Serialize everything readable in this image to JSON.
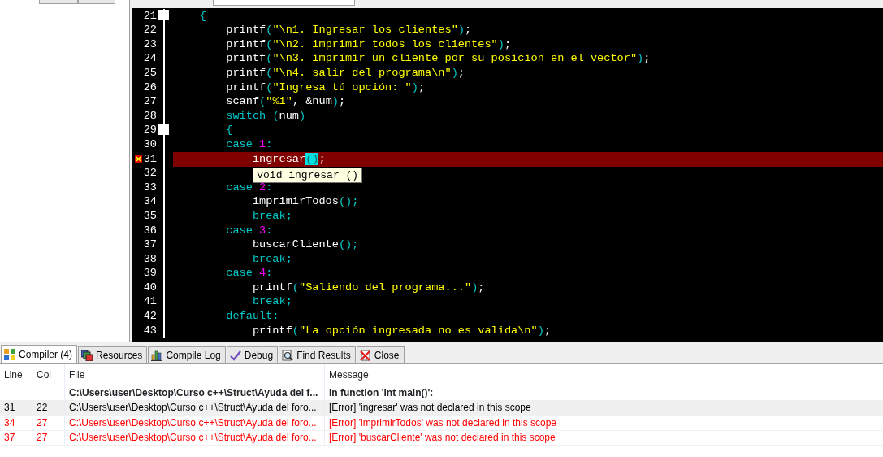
{
  "editor": {
    "lines": [
      {
        "number": "21",
        "fold": true,
        "error": false,
        "tokens": [
          {
            "kind": "punct",
            "text": "    {"
          }
        ]
      },
      {
        "number": "22",
        "fold": false,
        "error": false,
        "tokens": [
          {
            "kind": "plain",
            "text": "        printf"
          },
          {
            "kind": "punct",
            "text": "("
          },
          {
            "kind": "str",
            "text": "\"\\n1. Ingresar los clientes\""
          },
          {
            "kind": "punct",
            "text": ")"
          },
          {
            "kind": "plain",
            "text": ";"
          }
        ]
      },
      {
        "number": "23",
        "fold": false,
        "error": false,
        "tokens": [
          {
            "kind": "plain",
            "text": "        printf"
          },
          {
            "kind": "punct",
            "text": "("
          },
          {
            "kind": "str",
            "text": "\"\\n2. imprimir todos los clientes\""
          },
          {
            "kind": "punct",
            "text": ")"
          },
          {
            "kind": "plain",
            "text": ";"
          }
        ]
      },
      {
        "number": "24",
        "fold": false,
        "error": false,
        "tokens": [
          {
            "kind": "plain",
            "text": "        printf"
          },
          {
            "kind": "punct",
            "text": "("
          },
          {
            "kind": "str",
            "text": "\"\\n3. imprimir un cliente por su posicion en el vector\""
          },
          {
            "kind": "punct",
            "text": ")"
          },
          {
            "kind": "plain",
            "text": ";"
          }
        ]
      },
      {
        "number": "25",
        "fold": false,
        "error": false,
        "tokens": [
          {
            "kind": "plain",
            "text": "        printf"
          },
          {
            "kind": "punct",
            "text": "("
          },
          {
            "kind": "str",
            "text": "\"\\n4. salir del programa\\n\""
          },
          {
            "kind": "punct",
            "text": ")"
          },
          {
            "kind": "plain",
            "text": ";"
          }
        ]
      },
      {
        "number": "26",
        "fold": false,
        "error": false,
        "tokens": [
          {
            "kind": "plain",
            "text": "        printf"
          },
          {
            "kind": "punct",
            "text": "("
          },
          {
            "kind": "str",
            "text": "\"Ingresa tú opción: \""
          },
          {
            "kind": "punct",
            "text": ")"
          },
          {
            "kind": "plain",
            "text": ";"
          }
        ]
      },
      {
        "number": "27",
        "fold": false,
        "error": false,
        "tokens": [
          {
            "kind": "plain",
            "text": "        scanf"
          },
          {
            "kind": "punct",
            "text": "("
          },
          {
            "kind": "str",
            "text": "\"%i\""
          },
          {
            "kind": "plain",
            "text": ", &num"
          },
          {
            "kind": "punct",
            "text": ")"
          },
          {
            "kind": "plain",
            "text": ";"
          }
        ]
      },
      {
        "number": "28",
        "fold": false,
        "error": false,
        "tokens": [
          {
            "kind": "kw",
            "text": "        switch "
          },
          {
            "kind": "punct",
            "text": "("
          },
          {
            "kind": "plain",
            "text": "num"
          },
          {
            "kind": "punct",
            "text": ")"
          }
        ]
      },
      {
        "number": "29",
        "fold": true,
        "error": false,
        "tokens": [
          {
            "kind": "punct",
            "text": "        {"
          }
        ]
      },
      {
        "number": "30",
        "fold": false,
        "error": false,
        "tokens": [
          {
            "kind": "kw",
            "text": "        case "
          },
          {
            "kind": "num",
            "text": "1"
          },
          {
            "kind": "punct",
            "text": ":"
          }
        ]
      },
      {
        "number": "31",
        "fold": false,
        "error": true,
        "tokens": [
          {
            "kind": "plain",
            "text": "            ingresar"
          },
          {
            "kind": "match",
            "text": "()"
          },
          {
            "kind": "plain",
            "text": ";"
          }
        ],
        "tooltip": "void ingresar ()"
      },
      {
        "number": "32",
        "fold": false,
        "error": false
      },
      {
        "number": "33",
        "fold": false,
        "error": false,
        "tokens": [
          {
            "kind": "kw",
            "text": "        case "
          },
          {
            "kind": "num",
            "text": "2"
          },
          {
            "kind": "punct",
            "text": ":"
          }
        ]
      },
      {
        "number": "34",
        "fold": false,
        "error": false,
        "tokens": [
          {
            "kind": "plain",
            "text": "            imprimirTodos"
          },
          {
            "kind": "punct",
            "text": "();"
          }
        ]
      },
      {
        "number": "35",
        "fold": false,
        "error": false,
        "tokens": [
          {
            "kind": "kw",
            "text": "            break;"
          }
        ]
      },
      {
        "number": "36",
        "fold": false,
        "error": false,
        "tokens": [
          {
            "kind": "kw",
            "text": "        case "
          },
          {
            "kind": "num",
            "text": "3"
          },
          {
            "kind": "punct",
            "text": ":"
          }
        ]
      },
      {
        "number": "37",
        "fold": false,
        "error": false,
        "tokens": [
          {
            "kind": "plain",
            "text": "            buscarCliente"
          },
          {
            "kind": "punct",
            "text": "();"
          }
        ]
      },
      {
        "number": "38",
        "fold": false,
        "error": false,
        "tokens": [
          {
            "kind": "kw",
            "text": "            break;"
          }
        ]
      },
      {
        "number": "39",
        "fold": false,
        "error": false,
        "tokens": [
          {
            "kind": "kw",
            "text": "        case "
          },
          {
            "kind": "num",
            "text": "4"
          },
          {
            "kind": "punct",
            "text": ":"
          }
        ]
      },
      {
        "number": "40",
        "fold": false,
        "error": false,
        "tokens": [
          {
            "kind": "plain",
            "text": "            printf"
          },
          {
            "kind": "punct",
            "text": "("
          },
          {
            "kind": "str",
            "text": "\"Saliendo del programa...\""
          },
          {
            "kind": "punct",
            "text": ")"
          },
          {
            "kind": "plain",
            "text": ";"
          }
        ]
      },
      {
        "number": "41",
        "fold": false,
        "error": false,
        "tokens": [
          {
            "kind": "kw",
            "text": "            break;"
          }
        ]
      },
      {
        "number": "42",
        "fold": false,
        "error": false,
        "tokens": [
          {
            "kind": "kw",
            "text": "        default:"
          }
        ]
      },
      {
        "number": "43",
        "fold": false,
        "error": false,
        "tokens": [
          {
            "kind": "plain",
            "text": "            printf"
          },
          {
            "kind": "punct",
            "text": "("
          },
          {
            "kind": "str",
            "text": "\"La opción ingresada no es valida\\n\""
          },
          {
            "kind": "punct",
            "text": ")"
          },
          {
            "kind": "plain",
            "text": ";"
          }
        ]
      }
    ]
  },
  "bottom_tabs": [
    {
      "label": "Compiler (4)",
      "selected": true
    },
    {
      "label": "Resources",
      "selected": false
    },
    {
      "label": "Compile Log",
      "selected": false
    },
    {
      "label": "Debug",
      "selected": false
    },
    {
      "label": "Find Results",
      "selected": false
    },
    {
      "label": "Close",
      "selected": false
    }
  ],
  "messages": {
    "columns": [
      "Line",
      "Col",
      "File",
      "Message"
    ],
    "rows": [
      {
        "kind": "context",
        "selected": false,
        "file": "C:\\Users\\user\\Desktop\\Curso c++\\Struct\\Ayuda del f...",
        "message": "In function 'int main()':"
      },
      {
        "kind": "error",
        "selected": true,
        "line": "31",
        "col": "22",
        "file": "C:\\Users\\user\\Desktop\\Curso c++\\Struct\\Ayuda del foro...",
        "message": "[Error] 'ingresar' was not declared in this scope"
      },
      {
        "kind": "error",
        "selected": false,
        "line": "34",
        "col": "27",
        "file": "C:\\Users\\user\\Desktop\\Curso c++\\Struct\\Ayuda del foro...",
        "message": "[Error] 'imprimirTodos' was not declared in this scope"
      },
      {
        "kind": "error",
        "selected": false,
        "line": "37",
        "col": "27",
        "file": "C:\\Users\\user\\Desktop\\Curso c++\\Struct\\Ayuda del foro...",
        "message": "[Error] 'buscarCliente' was not declared in this scope"
      }
    ]
  }
}
